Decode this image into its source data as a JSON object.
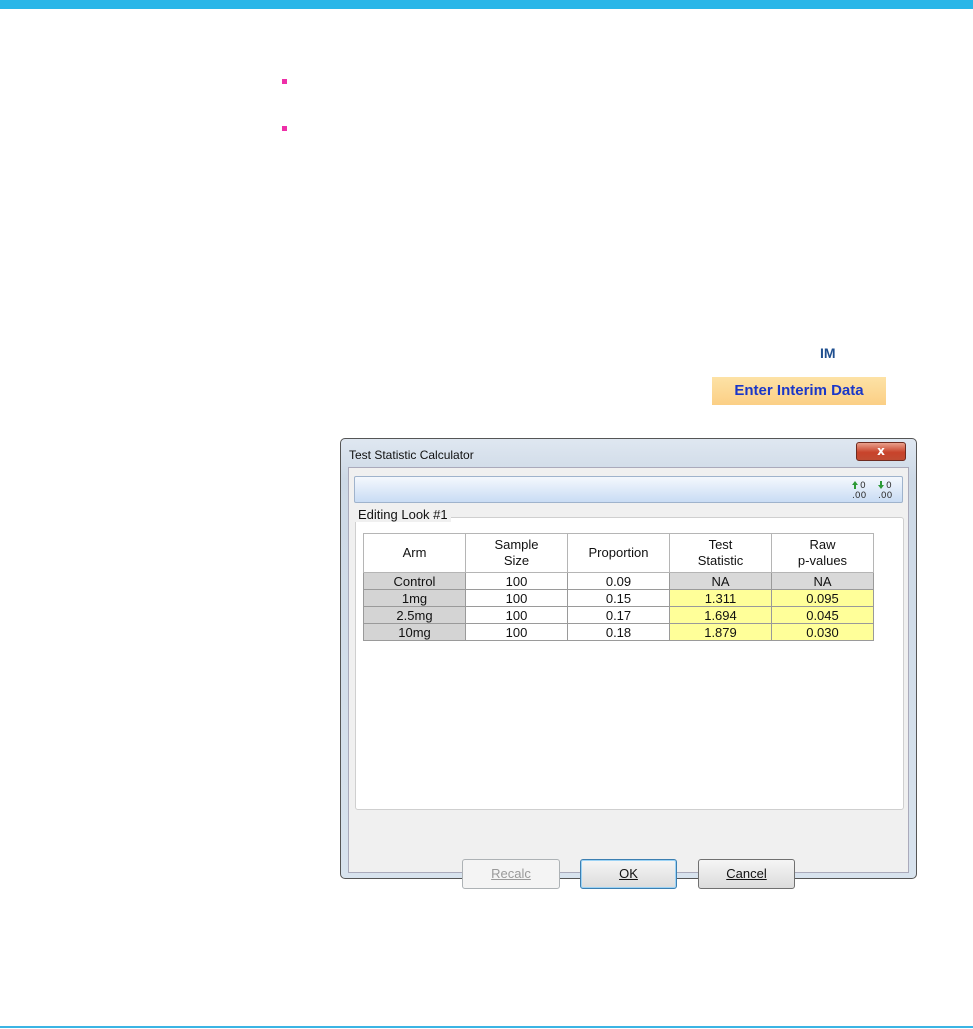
{
  "page": {
    "bullets": [
      "",
      ""
    ],
    "im_label": "IM",
    "enter_button": "Enter Interim Data"
  },
  "dialog": {
    "title": "Test Statistic Calculator",
    "close_glyph": "x",
    "toolbar": {
      "icons": [
        "increase-decimals-icon",
        "decrease-decimals-icon"
      ],
      "icon_text": [
        ".00",
        ".00"
      ]
    },
    "group_label": "Editing Look #1",
    "table": {
      "headers": [
        [
          "Arm"
        ],
        [
          "Sample",
          "Size"
        ],
        [
          "Proportion"
        ],
        [
          "Test",
          "Statistic"
        ],
        [
          "Raw",
          "p-values"
        ]
      ],
      "rows": [
        {
          "arm": "Control",
          "sample_size": "100",
          "proportion": "0.09",
          "test_statistic": "NA",
          "p_value": "NA"
        },
        {
          "arm": "1mg",
          "sample_size": "100",
          "proportion": "0.15",
          "test_statistic": "1.311",
          "p_value": "0.095"
        },
        {
          "arm": "2.5mg",
          "sample_size": "100",
          "proportion": "0.17",
          "test_statistic": "1.694",
          "p_value": "0.045"
        },
        {
          "arm": "10mg",
          "sample_size": "100",
          "proportion": "0.18",
          "test_statistic": "1.879",
          "p_value": "0.030"
        }
      ]
    },
    "buttons": {
      "recalc": "Recalc",
      "ok": "OK",
      "cancel": "Cancel"
    },
    "colors": {
      "computed_cell": "#ffff99",
      "na_cell": "#d9d9d9",
      "arm_cell": "#d4d4d4"
    }
  }
}
